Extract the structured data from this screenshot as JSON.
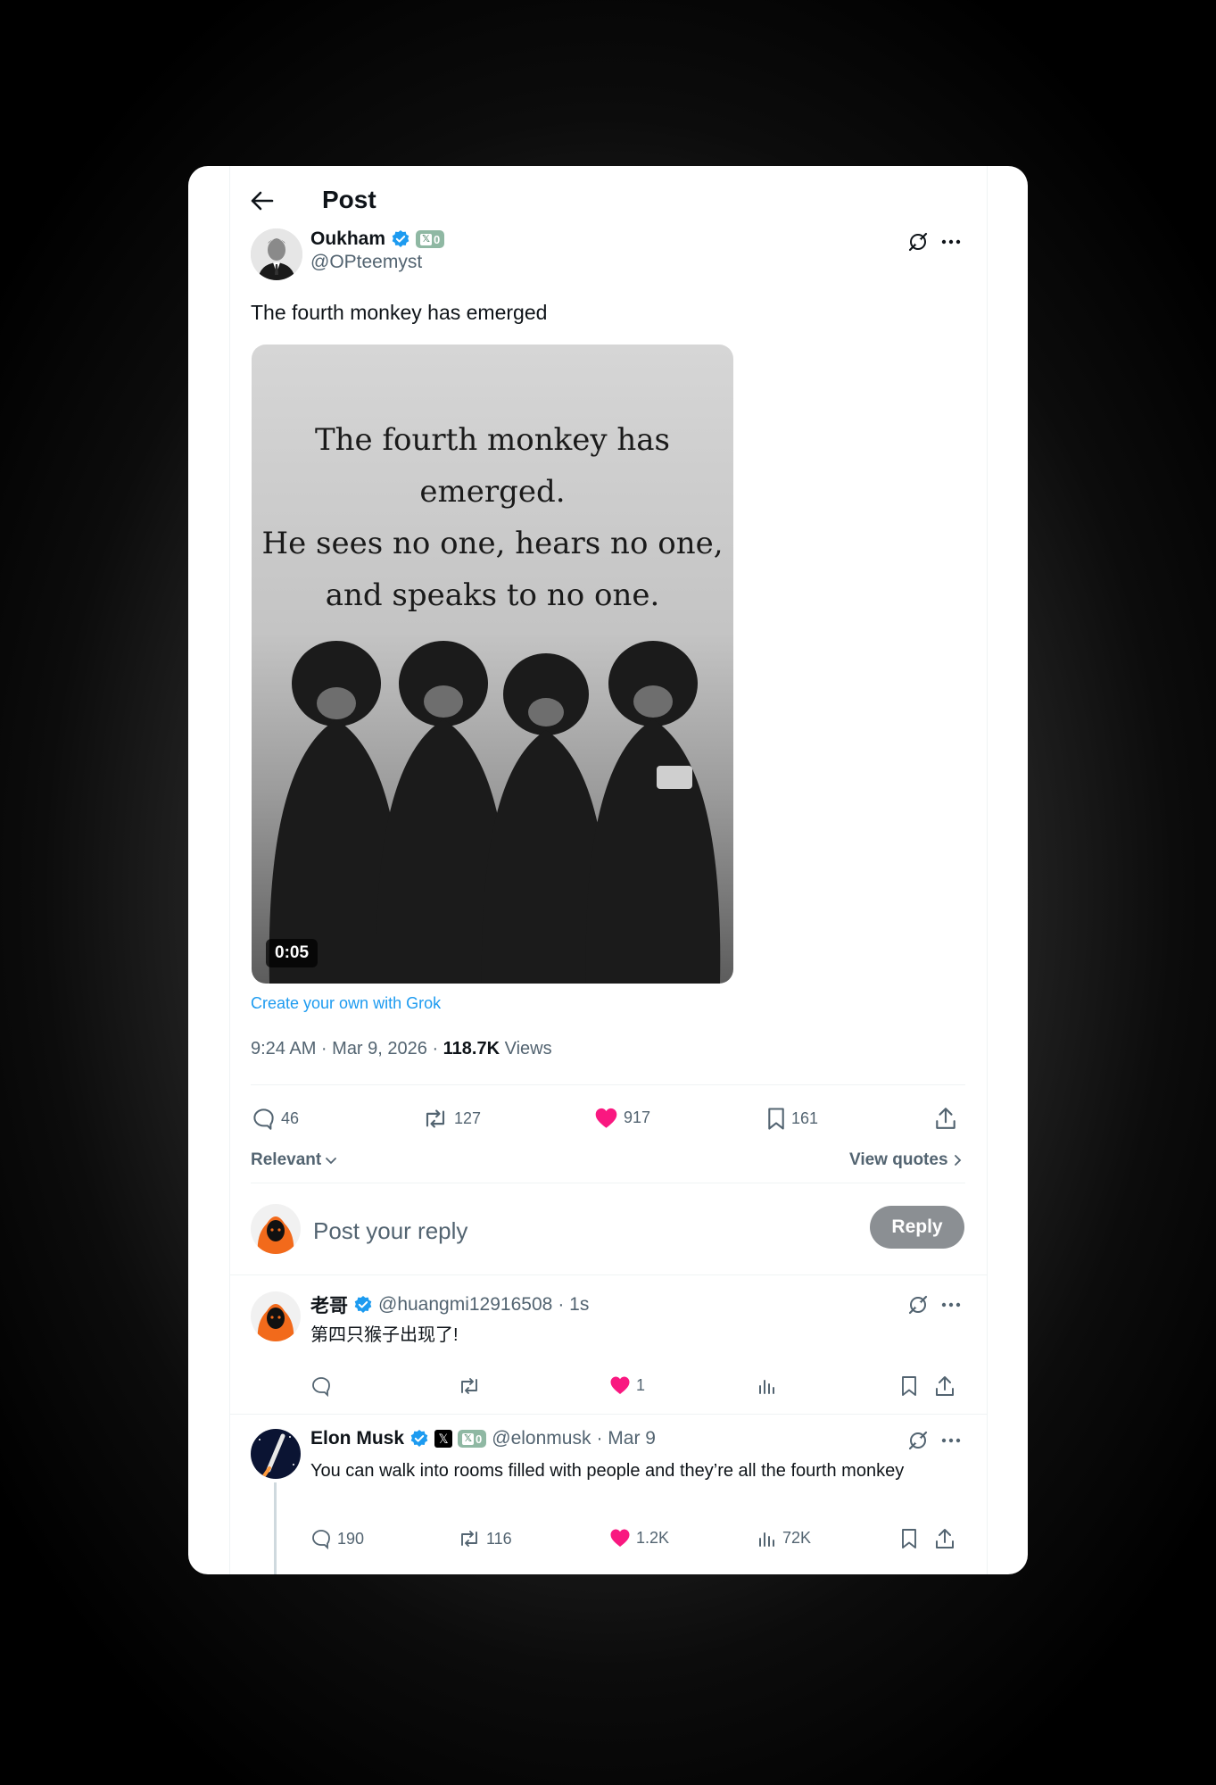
{
  "header": {
    "title": "Post"
  },
  "post": {
    "author_name": "Oukham",
    "author_handle": "@OPteemyst",
    "badge_count": "0",
    "text": "The fourth monkey has emerged",
    "media": {
      "caption": "The fourth monkey has emerged.\nHe sees no one, hears no one,\nand speaks to no one.",
      "duration": "0:05"
    },
    "grok_link": "Create your own with Grok",
    "timestamp": "9:24 AM · Mar 9, 2026 · ",
    "views_count": "118.7K",
    "views_label": " Views",
    "stats": {
      "replies": "46",
      "reposts": "127",
      "likes": "917",
      "bookmarks": "161"
    }
  },
  "sort": {
    "label": "Relevant",
    "quotes_label": "View quotes"
  },
  "composer": {
    "placeholder": "Post your reply",
    "button_label": "Reply"
  },
  "replies": [
    {
      "name": "老哥",
      "handle": "@huangmi12916508",
      "time": "· 1s",
      "text": "第四只猴子出现了!",
      "likes": "1"
    },
    {
      "name": "Elon Musk",
      "handle": "@elonmusk",
      "time": "· Mar 9",
      "badge_count": "0",
      "text": "You can walk into rooms filled with people and they’re all the fourth monkey",
      "replies": "190",
      "reposts": "116",
      "likes": "1.2K",
      "views": "72K"
    }
  ],
  "colors": {
    "accent": "#1d9bf0",
    "like": "#f91880",
    "muted": "#536471",
    "verified": "#1d9bf0"
  }
}
